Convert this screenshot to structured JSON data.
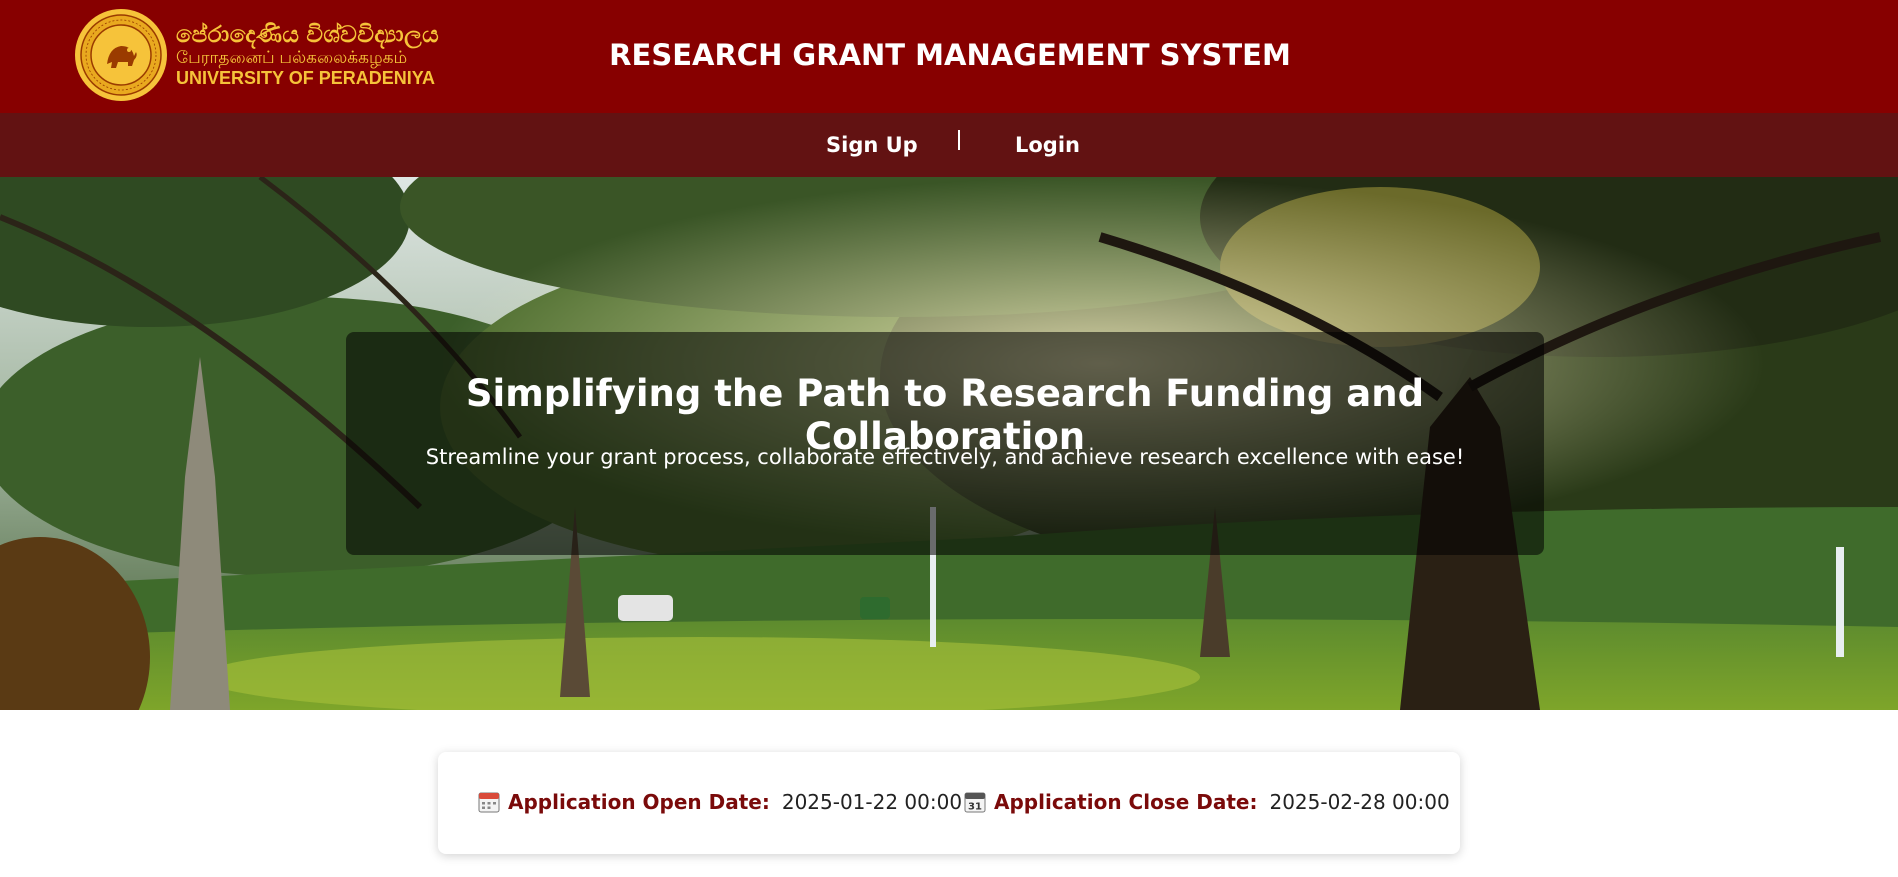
{
  "header": {
    "logo": {
      "line1": "පේරාදෙණිය විශ්වවිද්‍යාලය",
      "line2": "பேராதனைப் பல்கலைக்கழகம்",
      "line3": "UNIVERSITY OF PERADENIYA"
    },
    "title": "RESEARCH GRANT MANAGEMENT SYSTEM"
  },
  "nav": {
    "signup": "Sign Up",
    "login": "Login"
  },
  "hero": {
    "title": "Simplifying the Path to Research Funding and Collaboration",
    "subtitle": "Streamline your grant process, collaborate effectively, and achieve research excellence with ease!"
  },
  "dates": {
    "open_label": "Application Open Date:",
    "open_value": "2025-01-22 00:00",
    "close_label": "Application Close Date:",
    "close_value": "2025-02-28 00:00"
  },
  "icons": {
    "seal": "university-seal-icon",
    "open": "calendar-icon",
    "close": "calendar-31-icon"
  },
  "colors": {
    "header_bg": "#870000",
    "nav_bg": "#621212",
    "logo_gold": "#f6c33a",
    "date_label": "#7a0a0a"
  }
}
